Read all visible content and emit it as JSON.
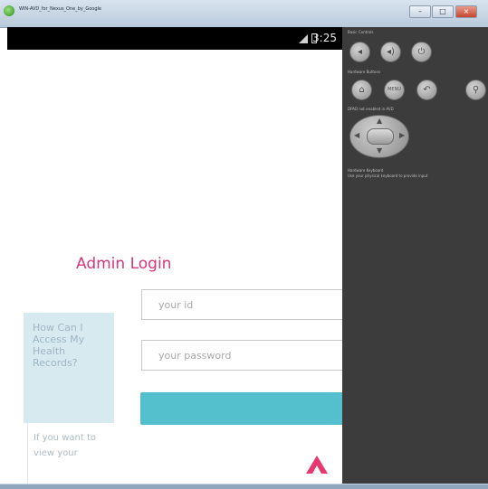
{
  "window": {
    "title": "WIN-AVD_for_Nexus_One_by_Google",
    "buttons": {
      "minimize": "–",
      "maximize": "□",
      "close": "×"
    }
  },
  "device": {
    "status_bar": {
      "time": "3:25"
    },
    "login": {
      "title": "Admin Login",
      "id_placeholder": "your id",
      "password_placeholder": "your password",
      "submit_label": ""
    },
    "help": {
      "question": "How Can I Access My Health Records?",
      "answer_snippet": "If you want to view your"
    },
    "accent_colors": {
      "title": "#d6357a",
      "button": "#55c0cd",
      "arrow": "#e6386f",
      "help_bg": "#d6eaf0"
    }
  },
  "emulator_controls": {
    "sections": {
      "basic": "Basic Controls",
      "hardware": "Hardware Buttons",
      "dpad": "DPAD not enabled in AVD",
      "keyboard": "Hardware Keyboard",
      "keyboard_note": "Use your physical keyboard to provide input"
    },
    "basic_buttons": [
      {
        "icon": "volume-down-icon",
        "glyph": "◂"
      },
      {
        "icon": "volume-up-icon",
        "glyph": "◂)"
      },
      {
        "icon": "power-icon",
        "glyph": "⏻"
      }
    ],
    "hardware_buttons": [
      {
        "icon": "home-icon",
        "glyph": "⌂"
      },
      {
        "icon": "menu-icon",
        "glyph": "MENU"
      },
      {
        "icon": "back-icon",
        "glyph": "↶"
      },
      {
        "icon": "search-icon",
        "glyph": "⚲"
      }
    ]
  }
}
